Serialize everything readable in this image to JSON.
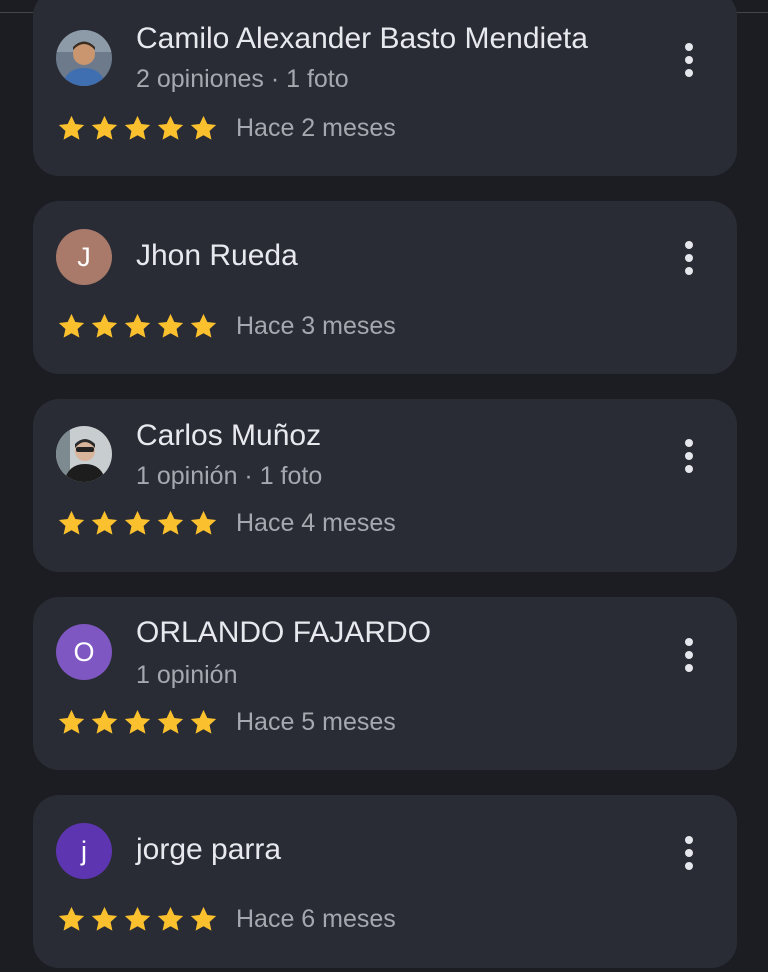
{
  "colors": {
    "background": "#1c1d22",
    "card": "#292c35",
    "star": "#fbc02d",
    "text_primary": "#e8e9ee",
    "text_secondary": "#a6a8b0"
  },
  "reviews": [
    {
      "name": "Camilo Alexander Basto Mendieta",
      "meta": "2 opiniones · 1 foto",
      "rating": 5,
      "date": "Hace 2 meses",
      "avatar": {
        "type": "photo",
        "icon": "user-photo-avatar"
      }
    },
    {
      "name": "Jhon Rueda",
      "meta": "",
      "rating": 5,
      "date": "Hace 3 meses",
      "avatar": {
        "type": "letter",
        "letter": "J",
        "color": "#a97a6a"
      }
    },
    {
      "name": "Carlos Muñoz",
      "meta": "1 opinión · 1 foto",
      "rating": 5,
      "date": "Hace 4 meses",
      "avatar": {
        "type": "photo",
        "icon": "user-photo-avatar"
      }
    },
    {
      "name": "ORLANDO FAJARDO",
      "meta": "1 opinión",
      "rating": 5,
      "date": "Hace 5 meses",
      "avatar": {
        "type": "letter",
        "letter": "O",
        "color": "#7e57c2"
      }
    },
    {
      "name": "jorge parra",
      "meta": "",
      "rating": 5,
      "date": "Hace 6 meses",
      "avatar": {
        "type": "letter",
        "letter": "j",
        "color": "#5e35b1"
      }
    }
  ],
  "more_options_icon": "more-vert-icon",
  "star_icon": "star-icon"
}
